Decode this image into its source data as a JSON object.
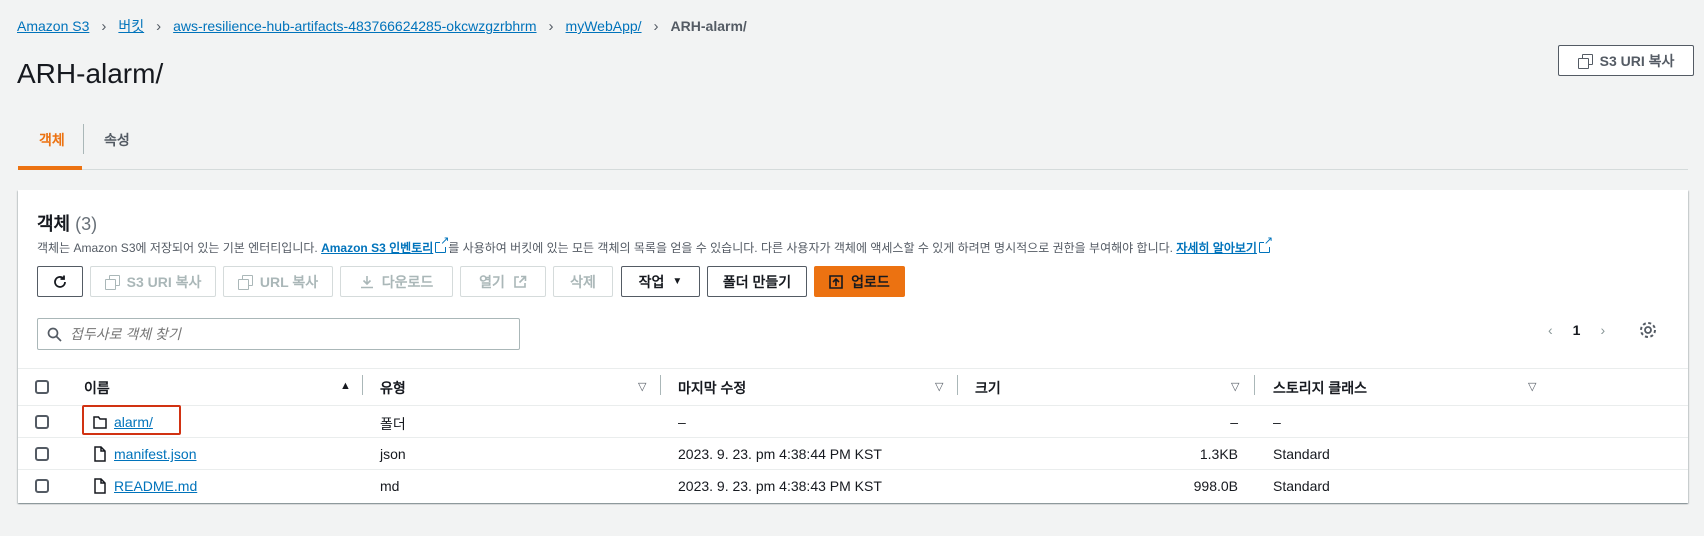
{
  "breadcrumb": {
    "items": [
      "Amazon S3",
      "버킷",
      "aws-resilience-hub-artifacts-483766624285-okcwzgzrbhrm",
      "myWebApp/"
    ],
    "current": "ARH-alarm/"
  },
  "page": {
    "title": "ARH-alarm/",
    "copy_uri_label": "S3 URI 복사"
  },
  "tabs": [
    {
      "label": "객체",
      "active": true
    },
    {
      "label": "속성",
      "active": false
    }
  ],
  "objects_panel": {
    "title": "객체",
    "count": "(3)",
    "desc_before": "객체는 Amazon S3에 저장되어 있는 기본 엔터티입니다. ",
    "desc_link1": "Amazon S3 인벤토리",
    "desc_middle": "를 사용하여 버킷에 있는 모든 객체의 목록을 얻을 수 있습니다. 다른 사용자가 객체에 액세스할 수 있게 하려면 명시적으로 권한을 부여해야 합니다. ",
    "desc_link2": "자세히 알아보기"
  },
  "toolbar": {
    "copy_s3_uri": "S3 URI 복사",
    "copy_url": "URL 복사",
    "download": "다운로드",
    "open": "열기",
    "delete": "삭제",
    "actions": "작업",
    "create_folder": "폴더 만들기",
    "upload": "업로드"
  },
  "search": {
    "placeholder": "접두사로 객체 찾기"
  },
  "pagination": {
    "current_page": "1"
  },
  "table": {
    "columns": [
      "이름",
      "유형",
      "마지막 수정",
      "크기",
      "스토리지 클래스"
    ],
    "rows": [
      {
        "name": "alarm/",
        "type": "폴더",
        "modified": "–",
        "size": "–",
        "storage": "–",
        "kind": "folder",
        "highlighted": true
      },
      {
        "name": "manifest.json",
        "type": "json",
        "modified": "2023. 9. 23. pm 4:38:44 PM KST",
        "size": "1.3KB",
        "storage": "Standard",
        "kind": "file"
      },
      {
        "name": "README.md",
        "type": "md",
        "modified": "2023. 9. 23. pm 4:38:43 PM KST",
        "size": "998.0B",
        "storage": "Standard",
        "kind": "file"
      }
    ]
  },
  "colors": {
    "accent": "#ec7211",
    "link": "#0073bb",
    "highlight_border": "#d13212"
  }
}
